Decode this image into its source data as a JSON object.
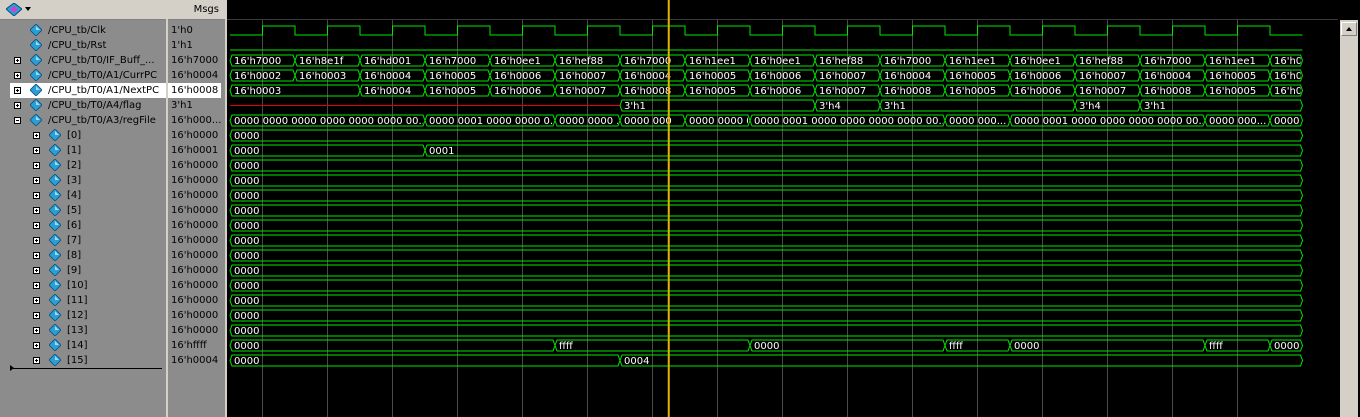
{
  "header": {
    "msgs_label": "Msgs"
  },
  "signals": [
    {
      "name": "/CPU_tb/Clk",
      "value": "1'h0",
      "expander": "none",
      "indent": 0
    },
    {
      "name": "/CPU_tb/Rst",
      "value": "1'h1",
      "expander": "none",
      "indent": 0
    },
    {
      "name": "/CPU_tb/T0/IF_Buff_...",
      "value": "16'h7000",
      "expander": "plus",
      "indent": 0
    },
    {
      "name": "/CPU_tb/T0/A1/CurrPC",
      "value": "16'h0004",
      "expander": "plus",
      "indent": 0
    },
    {
      "name": "/CPU_tb/T0/A1/NextPC",
      "value": "16'h0008",
      "expander": "plus",
      "indent": 0,
      "selected": true
    },
    {
      "name": "/CPU_tb/T0/A4/flag",
      "value": "3'h1",
      "expander": "plus",
      "indent": 0
    },
    {
      "name": "/CPU_tb/T0/A3/regFile",
      "value": "16'h000...",
      "expander": "minus",
      "indent": 0
    },
    {
      "name": "[0]",
      "value": "16'h0000",
      "expander": "plus",
      "indent": 1
    },
    {
      "name": "[1]",
      "value": "16'h0001",
      "expander": "plus",
      "indent": 1
    },
    {
      "name": "[2]",
      "value": "16'h0000",
      "expander": "plus",
      "indent": 1
    },
    {
      "name": "[3]",
      "value": "16'h0000",
      "expander": "plus",
      "indent": 1
    },
    {
      "name": "[4]",
      "value": "16'h0000",
      "expander": "plus",
      "indent": 1
    },
    {
      "name": "[5]",
      "value": "16'h0000",
      "expander": "plus",
      "indent": 1
    },
    {
      "name": "[6]",
      "value": "16'h0000",
      "expander": "plus",
      "indent": 1
    },
    {
      "name": "[7]",
      "value": "16'h0000",
      "expander": "plus",
      "indent": 1
    },
    {
      "name": "[8]",
      "value": "16'h0000",
      "expander": "plus",
      "indent": 1
    },
    {
      "name": "[9]",
      "value": "16'h0000",
      "expander": "plus",
      "indent": 1
    },
    {
      "name": "[10]",
      "value": "16'h0000",
      "expander": "plus",
      "indent": 1
    },
    {
      "name": "[11]",
      "value": "16'h0000",
      "expander": "plus",
      "indent": 1
    },
    {
      "name": "[12]",
      "value": "16'h0000",
      "expander": "plus",
      "indent": 1
    },
    {
      "name": "[13]",
      "value": "16'h0000",
      "expander": "plus",
      "indent": 1
    },
    {
      "name": "[14]",
      "value": "16'hffff",
      "expander": "plus",
      "indent": 1
    },
    {
      "name": "[15]",
      "value": "16'h0004",
      "expander": "plus",
      "indent": 1
    }
  ],
  "waveforms": {
    "clock": {
      "period": 1,
      "start_high": false,
      "cycles": 16.5
    },
    "rst": {
      "level": "low"
    },
    "buses": [
      {
        "signal": "/CPU_tb/T0/IF_Buff_...",
        "segments": [
          [
            "16'h7000",
            0
          ],
          [
            "16'h8e1f",
            1
          ],
          [
            "16'hd001",
            2
          ],
          [
            "16'h7000",
            3
          ],
          [
            "16'h0ee1",
            4
          ],
          [
            "16'hef88",
            5
          ],
          [
            "16'h7000",
            6
          ],
          [
            "16'h1ee1",
            7
          ],
          [
            "16'h0ee1",
            8
          ],
          [
            "16'hef88",
            9
          ],
          [
            "16'h7000",
            10
          ],
          [
            "16'h1ee1",
            11
          ],
          [
            "16'h0ee1",
            12
          ],
          [
            "16'hef88",
            13
          ],
          [
            "16'h7000",
            14
          ],
          [
            "16'h1ee1",
            15
          ],
          [
            "16'h0ee1",
            16
          ]
        ]
      },
      {
        "signal": "/CPU_tb/T0/A1/CurrPC",
        "segments": [
          [
            "16'h0002",
            0
          ],
          [
            "16'h0003",
            1
          ],
          [
            "16'h0004",
            2
          ],
          [
            "16'h0005",
            3
          ],
          [
            "16'h0006",
            4
          ],
          [
            "16'h0007",
            5
          ],
          [
            "16'h0004",
            6
          ],
          [
            "16'h0005",
            7
          ],
          [
            "16'h0006",
            8
          ],
          [
            "16'h0007",
            9
          ],
          [
            "16'h0004",
            10
          ],
          [
            "16'h0005",
            11
          ],
          [
            "16'h0006",
            12
          ],
          [
            "16'h0007",
            13
          ],
          [
            "16'h0004",
            14
          ],
          [
            "16'h0005",
            15
          ],
          [
            "16'h0006",
            16
          ]
        ]
      },
      {
        "signal": "/CPU_tb/T0/A1/NextPC",
        "segments": [
          [
            "16'h0003",
            0
          ],
          [
            "16'h0004",
            2
          ],
          [
            "16'h0005",
            3
          ],
          [
            "16'h0006",
            4
          ],
          [
            "16'h0007",
            5
          ],
          [
            "16'h0008",
            6
          ],
          [
            "16'h0005",
            7
          ],
          [
            "16'h0006",
            8
          ],
          [
            "16'h0007",
            9
          ],
          [
            "16'h0008",
            10
          ],
          [
            "16'h0005",
            11
          ],
          [
            "16'h0006",
            12
          ],
          [
            "16'h0007",
            13
          ],
          [
            "16'h0008",
            14
          ],
          [
            "16'h0005",
            15
          ],
          [
            "16'h0006",
            16
          ]
        ]
      },
      {
        "signal": "/CPU_tb/T0/A4/flag",
        "undefined_until": 6,
        "segments": [
          [
            "3'h1",
            6
          ],
          [
            "3'h4",
            9
          ],
          [
            "3'h1",
            10
          ],
          [
            "3'h4",
            13
          ],
          [
            "3'h1",
            14
          ]
        ]
      },
      {
        "signal": "/CPU_tb/T0/A3/regFile",
        "segments": [
          [
            "0000 0000 0000 0000 0000 0000 00...",
            0
          ],
          [
            "0000 0001 0000 0000 0...",
            3
          ],
          [
            "0000 0000 ...",
            5
          ],
          [
            "0000 000",
            6
          ],
          [
            "0000 0000 0...",
            7
          ],
          [
            "0000 0001 0000 0000 0000 0000 00...",
            8
          ],
          [
            "0000 000...",
            11
          ],
          [
            "0000 0001 0000 0000 0000 0000 00...",
            12
          ],
          [
            "0000 000...",
            15
          ],
          [
            "0000 0000 ...",
            16
          ]
        ]
      },
      {
        "signal": "[0]",
        "segments": [
          [
            "0000",
            0
          ]
        ]
      },
      {
        "signal": "[1]",
        "segments": [
          [
            "0000",
            0
          ],
          [
            "0001",
            3
          ]
        ]
      },
      {
        "signal": "[2]",
        "segments": [
          [
            "0000",
            0
          ]
        ]
      },
      {
        "signal": "[3]",
        "segments": [
          [
            "0000",
            0
          ]
        ]
      },
      {
        "signal": "[4]",
        "segments": [
          [
            "0000",
            0
          ]
        ]
      },
      {
        "signal": "[5]",
        "segments": [
          [
            "0000",
            0
          ]
        ]
      },
      {
        "signal": "[6]",
        "segments": [
          [
            "0000",
            0
          ]
        ]
      },
      {
        "signal": "[7]",
        "segments": [
          [
            "0000",
            0
          ]
        ]
      },
      {
        "signal": "[8]",
        "segments": [
          [
            "0000",
            0
          ]
        ]
      },
      {
        "signal": "[9]",
        "segments": [
          [
            "0000",
            0
          ]
        ]
      },
      {
        "signal": "[10]",
        "segments": [
          [
            "0000",
            0
          ]
        ]
      },
      {
        "signal": "[11]",
        "segments": [
          [
            "0000",
            0
          ]
        ]
      },
      {
        "signal": "[12]",
        "segments": [
          [
            "0000",
            0
          ]
        ]
      },
      {
        "signal": "[13]",
        "segments": [
          [
            "0000",
            0
          ]
        ]
      },
      {
        "signal": "[14]",
        "segments": [
          [
            "0000",
            0
          ],
          [
            "ffff",
            5
          ],
          [
            "0000",
            8
          ],
          [
            "ffff",
            11
          ],
          [
            "0000",
            12
          ],
          [
            "ffff",
            15
          ],
          [
            "0000",
            16
          ]
        ]
      },
      {
        "signal": "[15]",
        "segments": [
          [
            "0000",
            0
          ],
          [
            "0004",
            6
          ]
        ]
      }
    ],
    "cursor_time": 6.75
  },
  "colors": {
    "wave_green": "#00e600",
    "undefined_red": "#e60000",
    "cursor_yellow": "#e6b400",
    "grid": "#4a4a4a",
    "icon_blue": "#2a9fd6"
  },
  "icons": {
    "toolbar": "wave-window-icon",
    "signal": "diamond-signal-icon"
  }
}
